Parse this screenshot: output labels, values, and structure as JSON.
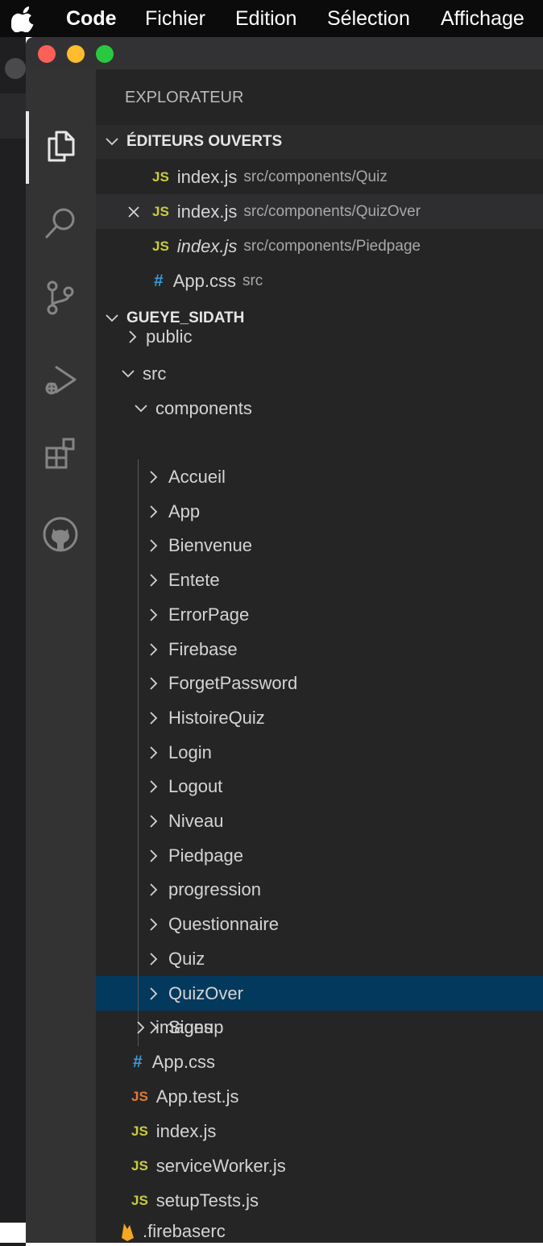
{
  "menubar": {
    "items": [
      "Code",
      "Fichier",
      "Edition",
      "Sélection",
      "Affichage"
    ]
  },
  "sidebar": {
    "title": "EXPLORATEUR",
    "open_editors": {
      "header": "ÉDITEURS OUVERTS",
      "items": [
        {
          "icon": "JS",
          "name": "index.js",
          "path": "src/components/Quiz"
        },
        {
          "icon": "JS",
          "name": "index.js",
          "path": "src/components/QuizOver"
        },
        {
          "icon": "JS",
          "name": "index.js",
          "path": "src/components/Piedpage"
        },
        {
          "icon": "#",
          "name": "App.css",
          "path": "src"
        }
      ]
    },
    "workspace": {
      "header": "GUEYE_SIDATH",
      "public": "public",
      "src": "src",
      "components": "components",
      "component_folders": [
        "Accueil",
        "App",
        "Bienvenue",
        "Entete",
        "ErrorPage",
        "Firebase",
        "ForgetPassword",
        "HistoireQuiz",
        "Login",
        "Logout",
        "Niveau",
        "Piedpage",
        "progression",
        "Questionnaire",
        "Quiz",
        "QuizOver",
        "Signup"
      ],
      "images": "images",
      "src_files": [
        {
          "icon": "#",
          "name": "App.css"
        },
        {
          "icon": "JS",
          "name": "App.test.js"
        },
        {
          "icon": "JS",
          "name": "index.js"
        },
        {
          "icon": "JS",
          "name": "serviceWorker.js"
        },
        {
          "icon": "JS",
          "name": "setupTests.js"
        }
      ],
      "root_file": ".firebaserc"
    }
  },
  "colors": {
    "activity_bar": "#333333",
    "sidebar": "#252526",
    "selection": "#04395e",
    "js_icon": "#cbcb41",
    "js_test_icon": "#e37933",
    "css_icon": "#3b9bd8",
    "firebase_icon": "#f5a623"
  }
}
